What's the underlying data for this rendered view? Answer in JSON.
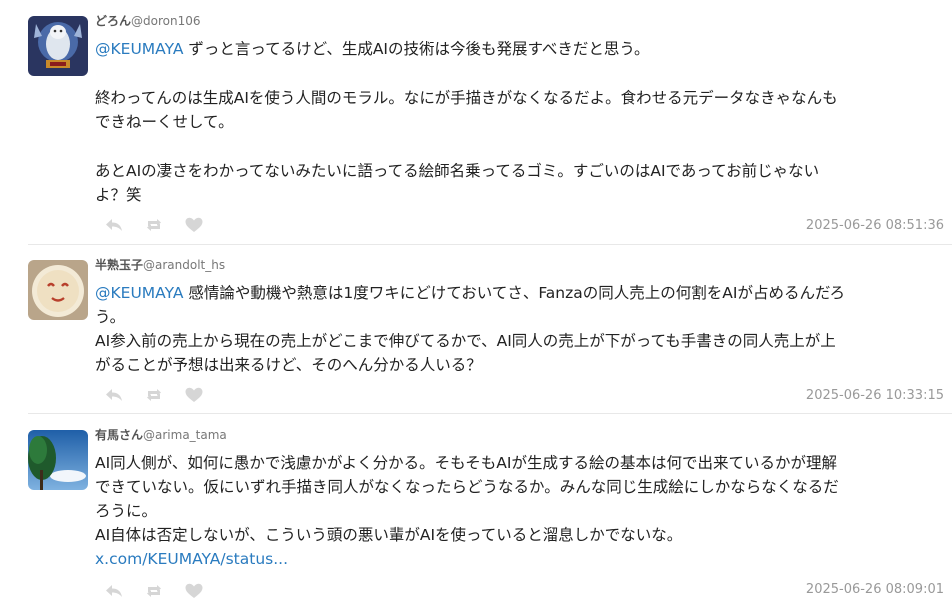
{
  "posts": [
    {
      "display_name": "どろん",
      "handle": "@doron106",
      "mention": "@KEUMAYA",
      "lines": [
        " ずっと言ってるけど、生成AIの技術は今後も発展すべきだと思う。",
        "",
        "終わってんのは生成AIを使う人間のモラル。なにが手描きがなくなるだよ。食わせる元データなきゃなんも",
        "できねーくせして。",
        "",
        "あとAIの凄さをわかってないみたいに語ってる絵師名乗ってるゴミ。すごいのはAIであってお前じゃない",
        "よ？笑"
      ],
      "timestamp": "2025-06-26 08:51:36"
    },
    {
      "display_name": "半熟玉子",
      "handle": "@arandolt_hs",
      "mention": "@KEUMAYA",
      "lines": [
        " 感情論や動機や熱意は1度ワキにどけておいてさ、Fanzaの同人売上の何割をAIが占めるんだろ",
        "う。",
        "AI参入前の売上から現在の売上がどこまで伸びてるかで、AI同人の売上が下がっても手書きの同人売上が上",
        "がることが予想は出来るけど、そのへん分かる人いる？"
      ],
      "timestamp": "2025-06-26 10:33:15"
    },
    {
      "display_name": "有馬さん",
      "handle": "@arima_tama",
      "lines": [
        "AI同人側が、如何に愚かで浅慮かがよく分かる。そもそもAIが生成する絵の基本は何で出来ているかが理解",
        "できていない。仮にいずれ手描き同人がなくなったらどうなるか。みんな同じ生成絵にしかならなくなるだ",
        "ろうに。",
        "AI自体は否定しないが、こういう頭の悪い輩がAIを使っていると溜息しかでないな。"
      ],
      "link": "x.com/KEUMAYA/status...",
      "timestamp": "2025-06-26 08:09:01"
    }
  ],
  "icons": {
    "reply": "reply-icon",
    "repost": "repost-icon",
    "like": "heart-icon"
  },
  "colors": {
    "mention": "#2a7bbf",
    "icon": "#d6d6d6",
    "timestamp": "#999999"
  }
}
